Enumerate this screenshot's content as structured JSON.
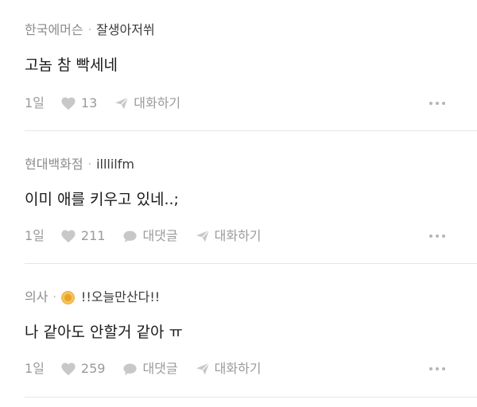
{
  "comments": [
    {
      "company": "한국에머슨",
      "separator": "·",
      "nickname": "잘생아저쒸",
      "text": "고놈 참 빡세네",
      "time": "1일",
      "likes": "13",
      "talk_label": "대화하기"
    },
    {
      "company": "현대백화점",
      "separator": "·",
      "nickname": "illlilfm",
      "text": "이미 애를 키우고 있네..;",
      "time": "1일",
      "likes": "211",
      "reply_label": "대댓글",
      "talk_label": "대화하기"
    },
    {
      "company": "의사",
      "separator": "·",
      "nickname": "!!오늘만산다!!",
      "text": "나 같아도 안할거 같아 ㅠ",
      "time": "1일",
      "likes": "259",
      "reply_label": "대댓글",
      "talk_label": "대화하기"
    }
  ],
  "icons": {
    "like": "heart-icon",
    "reply": "speech-bubble-icon",
    "talk": "paper-plane-icon",
    "more": "more-dots-icon"
  },
  "colors": {
    "meta_gray": "#9a9a9a",
    "heart": "#c8c8c8",
    "badge": "#e8a323"
  }
}
